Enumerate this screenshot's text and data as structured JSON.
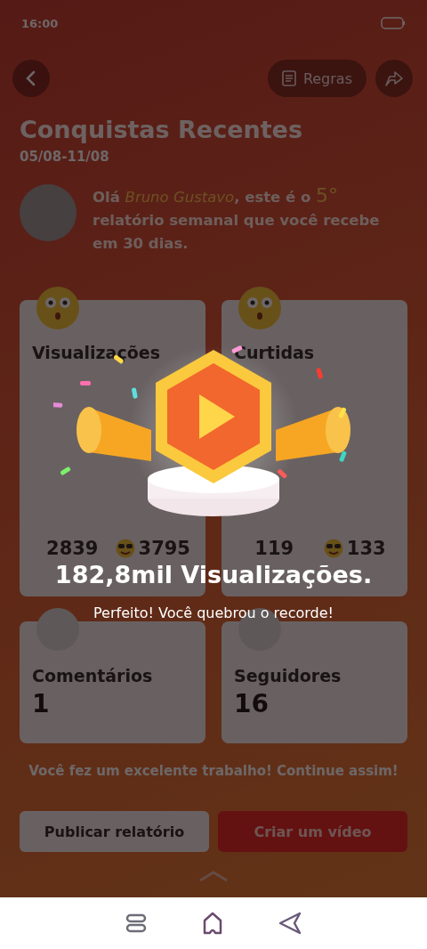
{
  "status_bar": {
    "time": "16:00"
  },
  "header": {
    "rules_button": "Regras"
  },
  "title": "Conquistas Recentes",
  "period": "05/08-11/08",
  "greeting": {
    "prefix": "Olá ",
    "name": "Bruno Gustavo",
    "middle": ", este é o ",
    "count": "5°",
    "suffix": " relatório semanal que você recebe em 30 dias."
  },
  "stats": [
    {
      "kind": "compare",
      "label": "Visualizações",
      "value": "2839",
      "best": "3795"
    },
    {
      "kind": "compare",
      "label": "Curtidas",
      "value": "119",
      "best": "133"
    },
    {
      "kind": "simple",
      "label": "Comentários",
      "value": "1"
    },
    {
      "kind": "simple",
      "label": "Seguidores",
      "value": "16"
    }
  ],
  "encouragement": "Você fez um excelente trabalho! Continue assim!",
  "actions": [
    {
      "label": "Publicar relatório",
      "kind": "secondary"
    },
    {
      "label": "Criar um vídeo",
      "kind": "primary"
    }
  ],
  "popup": {
    "headline": "182,8mil Visualizações.",
    "message": "Perfeito! Você quebrou o recorde!"
  }
}
